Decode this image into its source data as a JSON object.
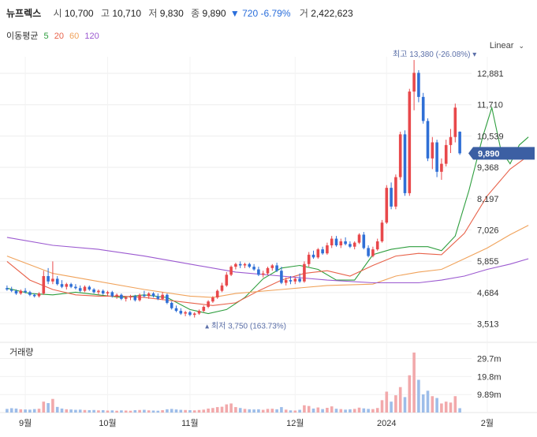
{
  "header": {
    "name": "뉴프렉스",
    "open_label": "시",
    "open": "10,700",
    "high_label": "고",
    "high": "10,710",
    "low_label": "저",
    "low": "9,830",
    "close_label": "종",
    "close": "9,890",
    "change": "▼ 720 -6.79%",
    "volume_label": "거",
    "volume": "2,422,623"
  },
  "moving_average": {
    "label": "이동평균",
    "periods": [
      {
        "text": "5",
        "color": "#2e9e3e"
      },
      {
        "text": "20",
        "color": "#e8624a"
      },
      {
        "text": "60",
        "color": "#f0a25a"
      },
      {
        "text": "120",
        "color": "#9b59d0"
      }
    ]
  },
  "scale_toggle": "Linear",
  "volume_title": "거래량",
  "colors": {
    "up": "#e8484b",
    "down": "#2f6fd6",
    "up_vol": "#f2a9ab",
    "down_vol": "#9dbde9",
    "badge": "#3c5fa3"
  },
  "chart_data": {
    "type": "candlestick",
    "ylim": [
      3000,
      13500
    ],
    "y_ticks": [
      {
        "value": 12881,
        "label": "12,881"
      },
      {
        "value": 11710,
        "label": "11,710"
      },
      {
        "value": 10539,
        "label": "10,539"
      },
      {
        "value": 9368,
        "label": "9,368"
      },
      {
        "value": 8197,
        "label": "8,197"
      },
      {
        "value": 7026,
        "label": "7,026"
      },
      {
        "value": 5855,
        "label": "5,855"
      },
      {
        "value": 4684,
        "label": "4,684"
      },
      {
        "value": 3513,
        "label": "3,513"
      }
    ],
    "x_ticks": [
      {
        "index": 4,
        "label": "9월"
      },
      {
        "index": 22,
        "label": "10월"
      },
      {
        "index": 40,
        "label": "11월"
      },
      {
        "index": 63,
        "label": "12월"
      },
      {
        "index": 83,
        "label": "2024"
      },
      {
        "index": 105,
        "label": "2월"
      }
    ],
    "current_price_label": "9,890",
    "current_price": 9890,
    "high_note": {
      "text": "최고 13,380 (-26.08%) ▾",
      "value": 13380,
      "index": 103
    },
    "low_note": {
      "text": "▴ 최저 3,750 (163.73%)",
      "value": 3750,
      "index": 44
    },
    "volume_ticks": [
      {
        "value": 29.7,
        "label": "29.7m"
      },
      {
        "value": 19.8,
        "label": "19.8m"
      },
      {
        "value": 9.89,
        "label": "9.89m"
      }
    ],
    "volume_max": 36,
    "ma_series": [
      {
        "name": "5",
        "color": "#2e9e3e",
        "values": [
          [
            0,
            4850
          ],
          [
            5,
            4650
          ],
          [
            10,
            4600
          ],
          [
            15,
            4700
          ],
          [
            20,
            4600
          ],
          [
            25,
            4500
          ],
          [
            30,
            4600
          ],
          [
            35,
            4500
          ],
          [
            40,
            4050
          ],
          [
            44,
            3900
          ],
          [
            48,
            4050
          ],
          [
            52,
            4500
          ],
          [
            56,
            5200
          ],
          [
            60,
            5600
          ],
          [
            64,
            5700
          ],
          [
            68,
            5550
          ],
          [
            72,
            5150
          ],
          [
            76,
            5150
          ],
          [
            80,
            6100
          ],
          [
            84,
            6300
          ],
          [
            88,
            6400
          ],
          [
            92,
            6400
          ],
          [
            95,
            6250
          ],
          [
            98,
            6800
          ],
          [
            101,
            8500
          ],
          [
            104,
            10500
          ],
          [
            106,
            11600
          ],
          [
            108,
            10000
          ],
          [
            110,
            9500
          ],
          [
            112,
            10200
          ],
          [
            114,
            10500
          ]
        ]
      },
      {
        "name": "20",
        "color": "#e8624a",
        "values": [
          [
            0,
            5850
          ],
          [
            5,
            5150
          ],
          [
            10,
            4800
          ],
          [
            15,
            4600
          ],
          [
            20,
            4550
          ],
          [
            25,
            4550
          ],
          [
            30,
            4500
          ],
          [
            35,
            4400
          ],
          [
            40,
            4300
          ],
          [
            45,
            4200
          ],
          [
            50,
            4300
          ],
          [
            55,
            4750
          ],
          [
            60,
            5150
          ],
          [
            65,
            5400
          ],
          [
            70,
            5500
          ],
          [
            75,
            5300
          ],
          [
            80,
            5700
          ],
          [
            85,
            6050
          ],
          [
            90,
            6150
          ],
          [
            95,
            6100
          ],
          [
            100,
            6900
          ],
          [
            105,
            8300
          ],
          [
            110,
            9300
          ],
          [
            114,
            9800
          ]
        ]
      },
      {
        "name": "60",
        "color": "#f0a25a",
        "values": [
          [
            0,
            6050
          ],
          [
            10,
            5400
          ],
          [
            20,
            5100
          ],
          [
            30,
            4800
          ],
          [
            40,
            4550
          ],
          [
            45,
            4500
          ],
          [
            50,
            4650
          ],
          [
            60,
            4800
          ],
          [
            70,
            4950
          ],
          [
            80,
            5000
          ],
          [
            85,
            5300
          ],
          [
            90,
            5450
          ],
          [
            95,
            5550
          ],
          [
            100,
            5950
          ],
          [
            105,
            6350
          ],
          [
            110,
            6850
          ],
          [
            114,
            7200
          ]
        ]
      },
      {
        "name": "120",
        "color": "#9b59d0",
        "values": [
          [
            0,
            6750
          ],
          [
            10,
            6450
          ],
          [
            20,
            6300
          ],
          [
            30,
            6050
          ],
          [
            40,
            5750
          ],
          [
            50,
            5450
          ],
          [
            60,
            5300
          ],
          [
            70,
            5150
          ],
          [
            80,
            5050
          ],
          [
            90,
            5050
          ],
          [
            95,
            5150
          ],
          [
            100,
            5300
          ],
          [
            105,
            5550
          ],
          [
            110,
            5750
          ],
          [
            114,
            5950
          ]
        ]
      }
    ],
    "candles": [
      {
        "o": 4850,
        "h": 4950,
        "l": 4750,
        "c": 4800,
        "v": 2.0
      },
      {
        "o": 4800,
        "h": 4900,
        "l": 4700,
        "c": 4750,
        "v": 2.4
      },
      {
        "o": 4750,
        "h": 4800,
        "l": 4600,
        "c": 4650,
        "v": 2.2
      },
      {
        "o": 4650,
        "h": 4800,
        "l": 4600,
        "c": 4750,
        "v": 1.8
      },
      {
        "o": 4750,
        "h": 4850,
        "l": 4650,
        "c": 4700,
        "v": 1.7
      },
      {
        "o": 4700,
        "h": 4750,
        "l": 4550,
        "c": 4600,
        "v": 1.6
      },
      {
        "o": 4600,
        "h": 4650,
        "l": 4500,
        "c": 4550,
        "v": 1.9
      },
      {
        "o": 4550,
        "h": 4700,
        "l": 4500,
        "c": 4650,
        "v": 2.1
      },
      {
        "o": 4650,
        "h": 5500,
        "l": 4600,
        "c": 5300,
        "v": 6.0
      },
      {
        "o": 5300,
        "h": 5600,
        "l": 5000,
        "c": 5100,
        "v": 5.2
      },
      {
        "o": 5100,
        "h": 5850,
        "l": 5000,
        "c": 5200,
        "v": 7.5
      },
      {
        "o": 5200,
        "h": 5300,
        "l": 4950,
        "c": 5000,
        "v": 3.1
      },
      {
        "o": 5000,
        "h": 5150,
        "l": 4850,
        "c": 4900,
        "v": 2.2
      },
      {
        "o": 4900,
        "h": 5050,
        "l": 4800,
        "c": 5000,
        "v": 1.8
      },
      {
        "o": 5000,
        "h": 5050,
        "l": 4850,
        "c": 4900,
        "v": 1.7
      },
      {
        "o": 4900,
        "h": 5000,
        "l": 4800,
        "c": 4850,
        "v": 1.5
      },
      {
        "o": 4850,
        "h": 4950,
        "l": 4700,
        "c": 4750,
        "v": 1.6
      },
      {
        "o": 4750,
        "h": 4950,
        "l": 4700,
        "c": 4900,
        "v": 1.4
      },
      {
        "o": 4900,
        "h": 4950,
        "l": 4750,
        "c": 4800,
        "v": 1.3
      },
      {
        "o": 4800,
        "h": 4850,
        "l": 4650,
        "c": 4700,
        "v": 1.4
      },
      {
        "o": 4700,
        "h": 4800,
        "l": 4600,
        "c": 4750,
        "v": 1.2
      },
      {
        "o": 4750,
        "h": 4800,
        "l": 4600,
        "c": 4650,
        "v": 1.3
      },
      {
        "o": 4650,
        "h": 4750,
        "l": 4550,
        "c": 4700,
        "v": 1.1
      },
      {
        "o": 4700,
        "h": 4750,
        "l": 4500,
        "c": 4550,
        "v": 1.2
      },
      {
        "o": 4550,
        "h": 4650,
        "l": 4450,
        "c": 4600,
        "v": 1.0
      },
      {
        "o": 4600,
        "h": 4650,
        "l": 4400,
        "c": 4450,
        "v": 1.2
      },
      {
        "o": 4450,
        "h": 4550,
        "l": 4350,
        "c": 4500,
        "v": 1.1
      },
      {
        "o": 4500,
        "h": 4600,
        "l": 4400,
        "c": 4550,
        "v": 1.0
      },
      {
        "o": 4550,
        "h": 4600,
        "l": 4350,
        "c": 4400,
        "v": 1.3
      },
      {
        "o": 4400,
        "h": 4650,
        "l": 4350,
        "c": 4600,
        "v": 1.4
      },
      {
        "o": 4600,
        "h": 4750,
        "l": 4500,
        "c": 4550,
        "v": 1.5
      },
      {
        "o": 4550,
        "h": 4700,
        "l": 4450,
        "c": 4650,
        "v": 1.2
      },
      {
        "o": 4650,
        "h": 4700,
        "l": 4500,
        "c": 4550,
        "v": 1.1
      },
      {
        "o": 4550,
        "h": 4650,
        "l": 4400,
        "c": 4450,
        "v": 1.0
      },
      {
        "o": 4450,
        "h": 4700,
        "l": 4400,
        "c": 4600,
        "v": 1.3
      },
      {
        "o": 4600,
        "h": 4650,
        "l": 4250,
        "c": 4300,
        "v": 1.8
      },
      {
        "o": 4300,
        "h": 4350,
        "l": 4050,
        "c": 4100,
        "v": 2.0
      },
      {
        "o": 4100,
        "h": 4200,
        "l": 3950,
        "c": 4000,
        "v": 1.7
      },
      {
        "o": 4000,
        "h": 4100,
        "l": 3850,
        "c": 3900,
        "v": 1.5
      },
      {
        "o": 3900,
        "h": 4000,
        "l": 3800,
        "c": 3950,
        "v": 1.4
      },
      {
        "o": 3950,
        "h": 4000,
        "l": 3800,
        "c": 3850,
        "v": 1.3
      },
      {
        "o": 3850,
        "h": 3950,
        "l": 3750,
        "c": 3900,
        "v": 1.2
      },
      {
        "o": 3900,
        "h": 4050,
        "l": 3850,
        "c": 4000,
        "v": 1.4
      },
      {
        "o": 4000,
        "h": 4200,
        "l": 3950,
        "c": 4150,
        "v": 1.6
      },
      {
        "o": 4150,
        "h": 4400,
        "l": 4100,
        "c": 4350,
        "v": 2.2
      },
      {
        "o": 4350,
        "h": 4550,
        "l": 4300,
        "c": 4500,
        "v": 2.5
      },
      {
        "o": 4500,
        "h": 4800,
        "l": 4450,
        "c": 4750,
        "v": 3.0
      },
      {
        "o": 4750,
        "h": 5050,
        "l": 4700,
        "c": 4950,
        "v": 3.2
      },
      {
        "o": 4950,
        "h": 5450,
        "l": 4900,
        "c": 5350,
        "v": 4.5
      },
      {
        "o": 5350,
        "h": 5700,
        "l": 5300,
        "c": 5650,
        "v": 5.0
      },
      {
        "o": 5650,
        "h": 5800,
        "l": 5550,
        "c": 5750,
        "v": 3.0
      },
      {
        "o": 5750,
        "h": 5850,
        "l": 5600,
        "c": 5700,
        "v": 2.5
      },
      {
        "o": 5700,
        "h": 5800,
        "l": 5600,
        "c": 5750,
        "v": 2.0
      },
      {
        "o": 5750,
        "h": 5800,
        "l": 5600,
        "c": 5650,
        "v": 1.8
      },
      {
        "o": 5650,
        "h": 5750,
        "l": 5500,
        "c": 5550,
        "v": 1.7
      },
      {
        "o": 5550,
        "h": 5650,
        "l": 5300,
        "c": 5350,
        "v": 1.8
      },
      {
        "o": 5350,
        "h": 5500,
        "l": 5250,
        "c": 5400,
        "v": 1.5
      },
      {
        "o": 5400,
        "h": 5650,
        "l": 5350,
        "c": 5600,
        "v": 2.0
      },
      {
        "o": 5600,
        "h": 5750,
        "l": 5500,
        "c": 5700,
        "v": 2.1
      },
      {
        "o": 5700,
        "h": 5800,
        "l": 5450,
        "c": 5500,
        "v": 1.8
      },
      {
        "o": 5500,
        "h": 5650,
        "l": 5000,
        "c": 5050,
        "v": 3.0
      },
      {
        "o": 5050,
        "h": 5250,
        "l": 4950,
        "c": 5150,
        "v": 1.6
      },
      {
        "o": 5150,
        "h": 5300,
        "l": 5000,
        "c": 5100,
        "v": 1.2
      },
      {
        "o": 5100,
        "h": 5250,
        "l": 5000,
        "c": 5200,
        "v": 1.1
      },
      {
        "o": 5200,
        "h": 5400,
        "l": 5050,
        "c": 5100,
        "v": 1.5
      },
      {
        "o": 5100,
        "h": 5850,
        "l": 5050,
        "c": 5750,
        "v": 4.0
      },
      {
        "o": 5750,
        "h": 6200,
        "l": 5650,
        "c": 6100,
        "v": 3.6
      },
      {
        "o": 6100,
        "h": 6250,
        "l": 5950,
        "c": 6000,
        "v": 2.2
      },
      {
        "o": 6000,
        "h": 6350,
        "l": 5950,
        "c": 6300,
        "v": 2.8
      },
      {
        "o": 6300,
        "h": 6400,
        "l": 6100,
        "c": 6150,
        "v": 1.9
      },
      {
        "o": 6150,
        "h": 6550,
        "l": 6100,
        "c": 6450,
        "v": 2.6
      },
      {
        "o": 6450,
        "h": 6800,
        "l": 6350,
        "c": 6700,
        "v": 3.4
      },
      {
        "o": 6700,
        "h": 6800,
        "l": 6400,
        "c": 6450,
        "v": 2.1
      },
      {
        "o": 6450,
        "h": 6700,
        "l": 6350,
        "c": 6600,
        "v": 1.9
      },
      {
        "o": 6600,
        "h": 6750,
        "l": 6450,
        "c": 6500,
        "v": 1.6
      },
      {
        "o": 6500,
        "h": 6600,
        "l": 6350,
        "c": 6400,
        "v": 1.8
      },
      {
        "o": 6400,
        "h": 6600,
        "l": 6300,
        "c": 6550,
        "v": 2.0
      },
      {
        "o": 6550,
        "h": 6900,
        "l": 6500,
        "c": 6850,
        "v": 2.7
      },
      {
        "o": 6850,
        "h": 6950,
        "l": 6300,
        "c": 6350,
        "v": 2.3
      },
      {
        "o": 6350,
        "h": 6450,
        "l": 6000,
        "c": 6050,
        "v": 2.0
      },
      {
        "o": 6050,
        "h": 6400,
        "l": 6000,
        "c": 6300,
        "v": 1.9
      },
      {
        "o": 6300,
        "h": 6700,
        "l": 6250,
        "c": 6600,
        "v": 2.5
      },
      {
        "o": 6600,
        "h": 7400,
        "l": 6550,
        "c": 7300,
        "v": 6.8
      },
      {
        "o": 7300,
        "h": 8700,
        "l": 7250,
        "c": 8600,
        "v": 11.5
      },
      {
        "o": 8600,
        "h": 8800,
        "l": 7800,
        "c": 7900,
        "v": 6.0
      },
      {
        "o": 7900,
        "h": 9100,
        "l": 7800,
        "c": 9000,
        "v": 9.5
      },
      {
        "o": 9000,
        "h": 10700,
        "l": 8900,
        "c": 10600,
        "v": 14.0
      },
      {
        "o": 10600,
        "h": 10750,
        "l": 8300,
        "c": 8400,
        "v": 8.5
      },
      {
        "o": 8400,
        "h": 12300,
        "l": 8300,
        "c": 12200,
        "v": 20.5
      },
      {
        "o": 12200,
        "h": 13380,
        "l": 11500,
        "c": 12900,
        "v": 33.0
      },
      {
        "o": 12900,
        "h": 13000,
        "l": 11800,
        "c": 12000,
        "v": 18.0
      },
      {
        "o": 12000,
        "h": 12150,
        "l": 11000,
        "c": 11100,
        "v": 10.0
      },
      {
        "o": 11100,
        "h": 11200,
        "l": 9600,
        "c": 9700,
        "v": 12.0
      },
      {
        "o": 9700,
        "h": 10500,
        "l": 9300,
        "c": 10300,
        "v": 9.0
      },
      {
        "o": 10300,
        "h": 10400,
        "l": 9000,
        "c": 9200,
        "v": 8.0
      },
      {
        "o": 9200,
        "h": 9700,
        "l": 8900,
        "c": 9500,
        "v": 5.0
      },
      {
        "o": 9500,
        "h": 10400,
        "l": 9400,
        "c": 10200,
        "v": 6.0
      },
      {
        "o": 10200,
        "h": 10800,
        "l": 9900,
        "c": 10500,
        "v": 5.5
      },
      {
        "o": 10500,
        "h": 11750,
        "l": 10300,
        "c": 11600,
        "v": 9.0
      },
      {
        "o": 10700,
        "h": 10710,
        "l": 9830,
        "c": 9890,
        "v": 2.4
      }
    ]
  }
}
